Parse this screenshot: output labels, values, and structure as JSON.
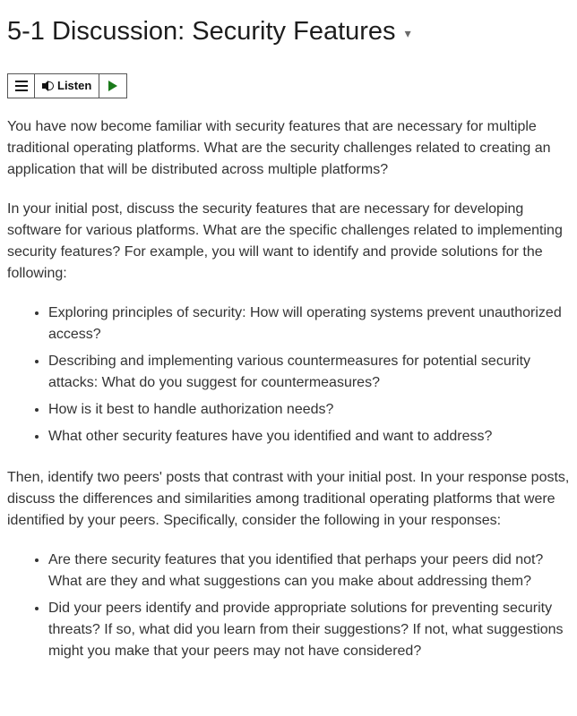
{
  "title": "5-1 Discussion: Security Features",
  "toolbar": {
    "listen_label": "Listen"
  },
  "body": {
    "intro": "You have now become familiar with security features that are necessary for multiple traditional operating platforms. What are the security challenges related to creating an application that will be distributed across multiple platforms?",
    "prompt": "In your initial post, discuss the security features that are necessary for developing software for various platforms. What are the specific challenges related to implementing security features? For example, you will want to identify and provide solutions for the following:",
    "list1": [
      "Exploring principles of security: How will operating systems prevent unauthorized access?",
      "Describing and implementing various countermeasures for potential security attacks: What do you suggest for countermeasures?",
      "How is it best to handle authorization needs?",
      "What other security features have you identified and want to address?"
    ],
    "response_intro": "Then, identify two peers' posts that contrast with your initial post. In your response posts, discuss the differences and similarities among traditional operating platforms that were identified by your peers. Specifically, consider the following in your responses:",
    "list2": [
      "Are there security features that you identified that perhaps your peers did not? What are they and what suggestions can you make about addressing them?",
      "Did your peers identify and provide appropriate solutions for preventing security threats? If so, what did you learn from their suggestions? If not, what suggestions might you make that your peers may not have considered?"
    ]
  }
}
